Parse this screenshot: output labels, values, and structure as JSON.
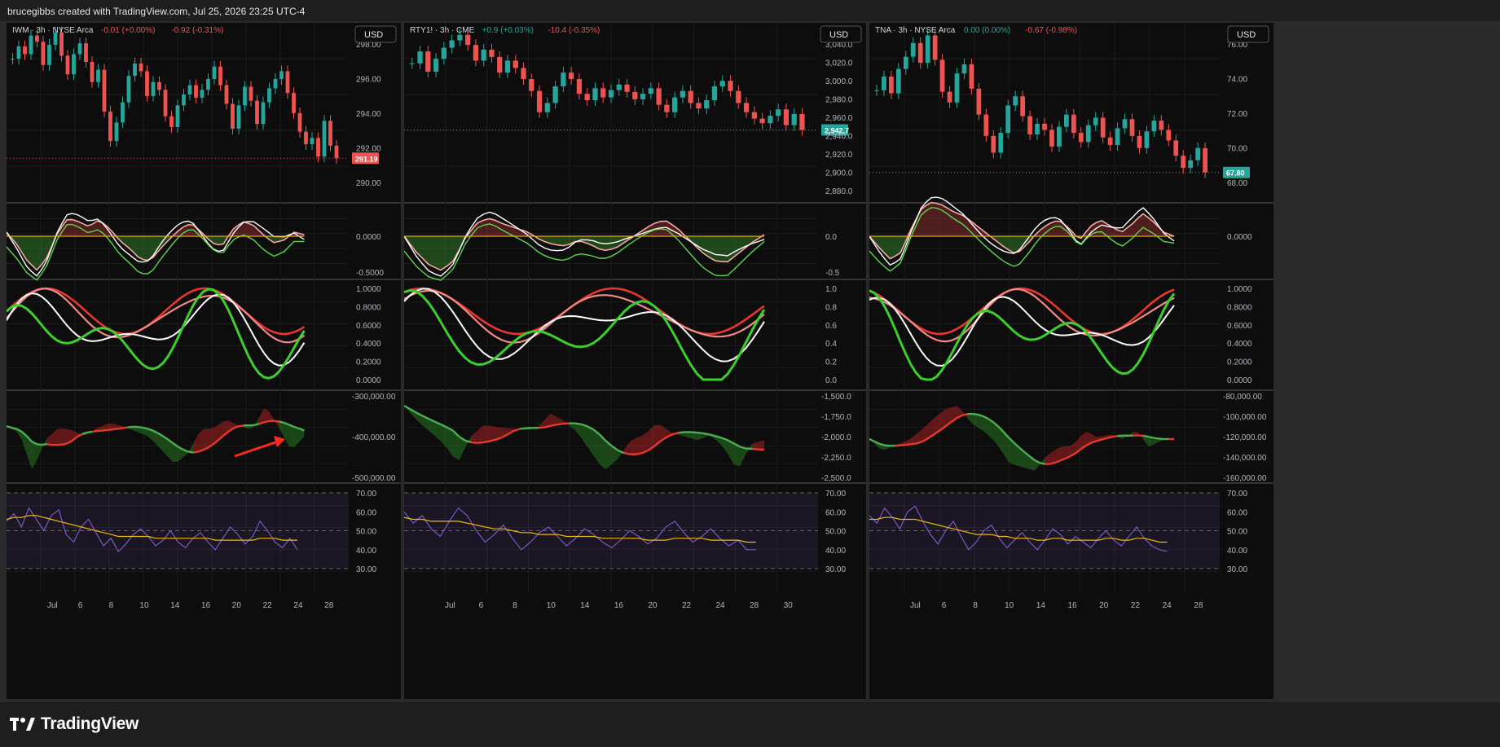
{
  "header": {
    "credit": "brucegibbs created with TradingView.com, Jul 25, 2026 23:25 UTC-4"
  },
  "footer": {
    "brand": "TradingView"
  },
  "colors": {
    "bg": "#0d0d0d",
    "up": "#26a69a",
    "down": "#ef5350",
    "rsi": "#7e57c2",
    "ma": "#f0b90b",
    "green": "#3ccf2c",
    "red": "#e8372f"
  },
  "panels": [
    {
      "id": "iwm",
      "symbol": "IWM · 3h · NYSE Arca",
      "change1": "-0.01 (+0.00%)",
      "change2": "-0.92 (-0.31%)",
      "currency": "USD",
      "price_label": "291.19",
      "price_color": "#ef5350",
      "price_axis": [
        "298.00",
        "296.00",
        "294.00",
        "292.00",
        "290.00"
      ],
      "irreg_axis": [
        "0.0000",
        "-0.5000"
      ],
      "tll_axis": [
        "1.0000",
        "0.8000",
        "0.6000",
        "0.4000",
        "0.2000",
        "0.0000"
      ],
      "sent_axis": [
        "-300,000.00",
        "-400,000.00",
        "-500,000.00"
      ],
      "rsi_value": "39.87",
      "rsi_ma": "45.00",
      "x_axis": [
        "Jul",
        "6",
        "8",
        "10",
        "14",
        "16",
        "20",
        "22",
        "24",
        "28"
      ],
      "chart_data": {
        "type": "candlestick",
        "ylim": [
          289,
          299.5
        ],
        "closes": [
          297.6,
          298.4,
          297.9,
          299.1,
          298.7,
          297.2,
          298.5,
          299.3,
          297.8,
          296.6,
          297.9,
          298.6,
          297.4,
          296.1,
          296.9,
          294.2,
          292.3,
          293.5,
          294.8,
          296.5,
          297.3,
          296.8,
          295.2,
          296.1,
          295.6,
          293.9,
          293.2,
          294.6,
          295.3,
          295.9,
          295.1,
          295.6,
          296.3,
          297.1,
          295.9,
          294.7,
          293.1,
          294.6,
          295.8,
          294.9,
          293.4,
          294.8,
          295.7,
          296.3,
          296.8,
          295.4,
          294.1,
          292.9,
          292.1,
          292.5,
          291.3,
          293.6,
          292.0,
          291.19
        ],
        "irreg": [
          0.05,
          -0.1,
          -0.3,
          -0.42,
          -0.25,
          0.05,
          0.22,
          0.18,
          0.12,
          0.2,
          0.1,
          -0.05,
          -0.15,
          -0.28,
          -0.3,
          -0.15,
          -0.02,
          0.1,
          0.16,
          0.05,
          -0.08,
          -0.12,
          0.08,
          0.18,
          0.14,
          0.02,
          -0.08,
          -0.05,
          0.05,
          0.02
        ],
        "sentiment": [
          -390000,
          -410000,
          -520000,
          -430000,
          -395000,
          -400000,
          -420000,
          -395000,
          -380000,
          -390000,
          -405000,
          -420000,
          -460000,
          -500000,
          -470000,
          -400000,
          -395000,
          -370000,
          -390000,
          -400000,
          -330000,
          -390000,
          -460000,
          -420000
        ],
        "rsi": [
          55,
          59,
          52,
          62,
          56,
          50,
          58,
          61,
          48,
          44,
          52,
          56,
          49,
          42,
          46,
          39,
          43,
          48,
          51,
          47,
          42,
          45,
          50,
          44,
          41,
          46,
          49,
          44,
          40,
          46,
          52,
          48,
          43,
          47,
          55,
          50,
          44,
          41,
          46,
          40
        ],
        "rsi_ma": [
          56,
          57,
          57,
          58,
          58,
          57,
          56,
          55,
          54,
          53,
          52,
          51,
          50,
          49,
          48,
          47,
          47,
          47,
          47,
          47,
          46,
          46,
          46,
          46,
          46,
          46,
          46,
          46,
          45,
          45,
          45,
          45,
          45,
          45,
          46,
          46,
          46,
          45,
          45,
          45
        ]
      }
    },
    {
      "id": "rty",
      "symbol": "RTY1! · 3h · CME",
      "change1": "+0.9 (+0.03%)",
      "change2": "-10.4 (-0.35%)",
      "currency": "USD",
      "price_label": "2,942.7",
      "price_color": "#26a69a",
      "price_axis": [
        "3,040.0",
        "3,020.0",
        "3,000.0",
        "2,980.0",
        "2,960.0",
        "2,940.0",
        "2,920.0",
        "2,900.0",
        "2,880.0"
      ],
      "irreg_axis": [
        "0.0",
        "-0.5"
      ],
      "tll_axis": [
        "1.0",
        "0.8",
        "0.6",
        "0.4",
        "0.2",
        "0.0"
      ],
      "sent_axis": [
        "-1,500.0",
        "-1,750.0",
        "-2,000.0",
        "-2,250.0",
        "-2,500.0"
      ],
      "rsi_value": "39.56",
      "rsi_ma": "44.35",
      "x_axis": [
        "Jul",
        "6",
        "8",
        "10",
        "14",
        "16",
        "20",
        "22",
        "24",
        "28",
        "30"
      ],
      "chart_data": {
        "type": "candlestick",
        "ylim": [
          2875,
          3052
        ],
        "closes": [
          3015,
          3028,
          3006,
          3020,
          3032,
          3040,
          3046,
          3035,
          3018,
          3030,
          3022,
          3005,
          3018,
          3010,
          2998,
          2985,
          2962,
          2972,
          2990,
          3005,
          2998,
          2982,
          2975,
          2988,
          2978,
          2986,
          2992,
          2984,
          2976,
          2982,
          2988,
          2970,
          2962,
          2978,
          2985,
          2972,
          2966,
          2975,
          2990,
          2996,
          2985,
          2972,
          2962,
          2955,
          2950,
          2958,
          2965,
          2948,
          2960,
          2942.7
        ],
        "irreg": [
          0.0,
          -0.2,
          -0.35,
          -0.42,
          -0.3,
          0.0,
          0.18,
          0.22,
          0.15,
          0.1,
          0.05,
          -0.05,
          -0.1,
          -0.12,
          -0.05,
          -0.1,
          -0.18,
          -0.15,
          -0.05,
          0.05,
          0.15,
          0.2,
          0.1,
          -0.05,
          -0.2,
          -0.3,
          -0.32,
          -0.2,
          -0.08,
          0.02
        ],
        "sentiment": [
          -1600,
          -1800,
          -1950,
          -2100,
          -2350,
          -2000,
          -1850,
          -1880,
          -1900,
          -1920,
          -1880,
          -1700,
          -1800,
          -1950,
          -2200,
          -2450,
          -2300,
          -2050,
          -1980,
          -1820,
          -1950,
          -2000,
          -2050,
          -1980,
          -2150,
          -2450,
          -2100,
          -2050
        ],
        "rsi": [
          60,
          54,
          58,
          51,
          47,
          55,
          62,
          58,
          50,
          44,
          48,
          53,
          46,
          40,
          44,
          49,
          52,
          47,
          42,
          46,
          51,
          48,
          44,
          41,
          45,
          50,
          47,
          43,
          46,
          52,
          55,
          49,
          44,
          47,
          51,
          46,
          42,
          45,
          40,
          40
        ],
        "rsi_ma": [
          57,
          56,
          56,
          55,
          55,
          55,
          55,
          54,
          53,
          52,
          51,
          51,
          50,
          49,
          49,
          48,
          48,
          48,
          47,
          47,
          47,
          47,
          46,
          46,
          46,
          46,
          46,
          45,
          45,
          45,
          46,
          46,
          46,
          46,
          45,
          45,
          45,
          45,
          44,
          44
        ]
      }
    },
    {
      "id": "tna",
      "symbol": "TNA · 3h · NYSE Arca",
      "change1": "0.00 (0.00%)",
      "change2": "-0.67 (-0.98%)",
      "currency": "USD",
      "price_label": "67.80",
      "price_color": "#26a69a",
      "price_axis": [
        "76.00",
        "74.00",
        "72.00",
        "70.00",
        "68.00"
      ],
      "irreg_axis": [
        "0.0000"
      ],
      "tll_axis": [
        "1.0000",
        "0.8000",
        "0.6000",
        "0.4000",
        "0.2000",
        "0.0000"
      ],
      "sent_axis": [
        "-80,000.00",
        "-100,000.00",
        "-120,000.00",
        "-140,000.00",
        "-160,000.00"
      ],
      "rsi_value": "39.10",
      "rsi_ma": "44.06",
      "x_axis": [
        "Jul",
        "6",
        "8",
        "10",
        "14",
        "16",
        "20",
        "22",
        "24",
        "28"
      ],
      "chart_data": {
        "type": "candlestick",
        "ylim": [
          66.5,
          77.2
        ],
        "closes": [
          73.2,
          74.1,
          73.0,
          74.6,
          75.4,
          76.3,
          75.0,
          76.8,
          75.2,
          73.1,
          72.4,
          74.3,
          74.9,
          73.3,
          71.6,
          70.2,
          69.1,
          70.4,
          72.2,
          72.8,
          71.5,
          70.3,
          71.0,
          70.6,
          69.5,
          70.8,
          71.6,
          70.4,
          69.8,
          70.9,
          71.4,
          70.1,
          69.6,
          70.7,
          71.3,
          70.2,
          69.4,
          70.5,
          71.2,
          70.6,
          69.9,
          68.9,
          68.1,
          68.6,
          69.4,
          67.8
        ],
        "irreg": [
          0.0,
          -0.15,
          -0.28,
          -0.2,
          0.1,
          0.35,
          0.42,
          0.38,
          0.3,
          0.25,
          0.15,
          0.05,
          -0.05,
          -0.15,
          -0.22,
          -0.1,
          0.05,
          0.15,
          0.2,
          0.1,
          -0.05,
          0.12,
          0.2,
          0.12,
          0.05,
          0.15,
          0.28,
          0.18,
          0.05,
          0.0
        ],
        "sentiment": [
          -110000,
          -125000,
          -118000,
          -112000,
          -100000,
          -85000,
          -72000,
          -68000,
          -90000,
          -100000,
          -115000,
          -140000,
          -145000,
          -150000,
          -130000,
          -120000,
          -118000,
          -100000,
          -108000,
          -104000,
          -110000,
          -98000,
          -120000,
          -112000,
          -108000
        ],
        "rsi": [
          58,
          54,
          62,
          57,
          51,
          60,
          63,
          55,
          48,
          43,
          50,
          55,
          47,
          40,
          44,
          50,
          53,
          46,
          41,
          45,
          49,
          44,
          40,
          45,
          51,
          48,
          43,
          47,
          44,
          41,
          46,
          50,
          45,
          42,
          47,
          52,
          46,
          42,
          40,
          39
        ],
        "rsi_ma": [
          56,
          56,
          57,
          57,
          56,
          56,
          56,
          55,
          54,
          53,
          52,
          51,
          50,
          49,
          48,
          48,
          48,
          47,
          47,
          46,
          46,
          46,
          45,
          45,
          46,
          46,
          45,
          45,
          45,
          45,
          45,
          46,
          46,
          45,
          45,
          46,
          46,
          45,
          44,
          44
        ]
      }
    }
  ]
}
